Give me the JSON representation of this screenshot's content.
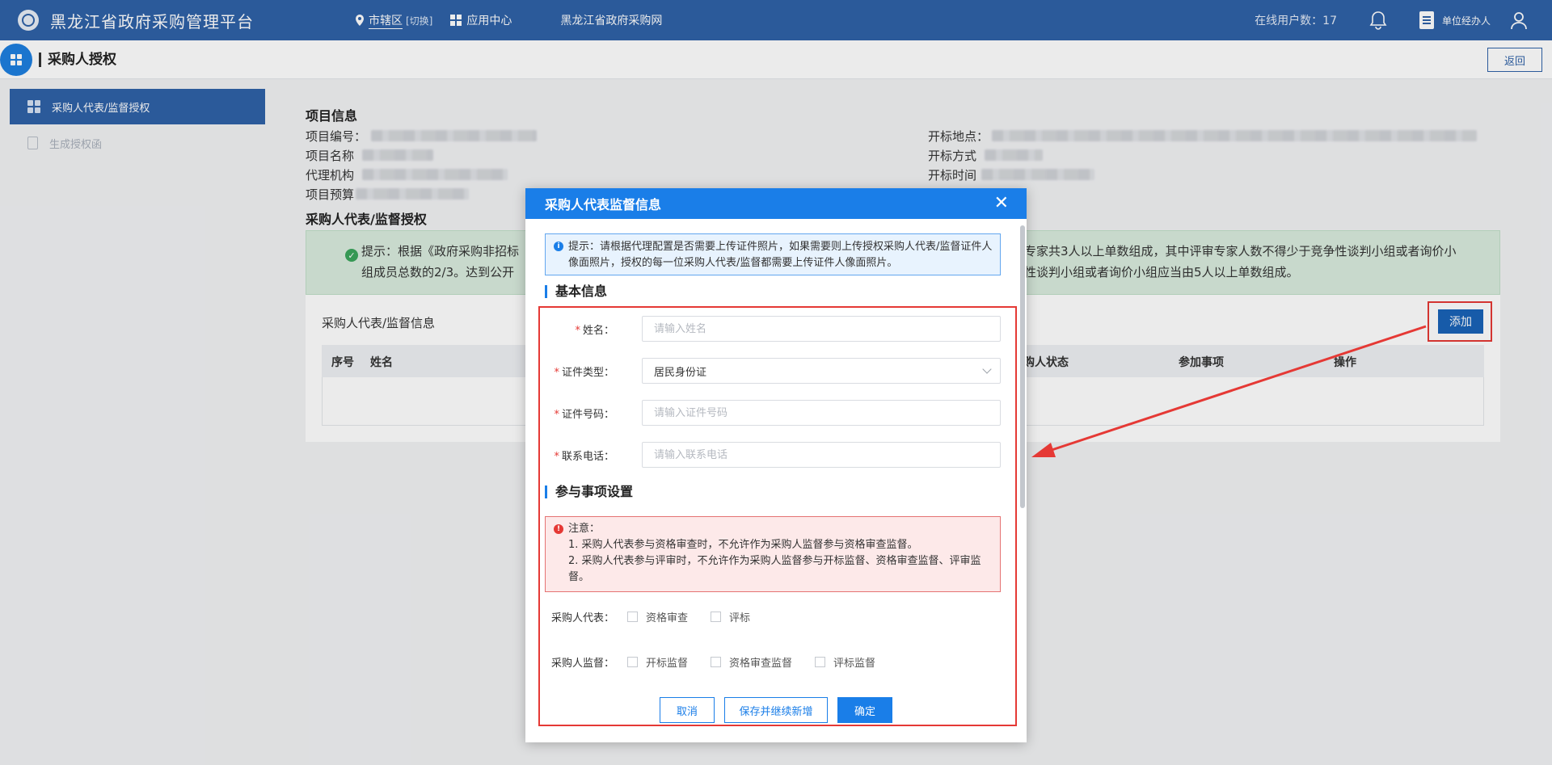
{
  "topbar": {
    "app_title": "黑龙江省政府采购管理平台",
    "region": "市辖区",
    "switch": "[切换]",
    "app_center": "应用中心",
    "gov_site": "黑龙江省政府采购网",
    "online_users": "在线用户数：17",
    "user_role": "单位经办人"
  },
  "page": {
    "title": "采购人授权",
    "back": "返回"
  },
  "sidebar": {
    "items": [
      {
        "label": "采购人代表/监督授权",
        "icon": "tiles-icon"
      },
      {
        "label": "生成授权函",
        "icon": "file-icon"
      }
    ]
  },
  "project_info": {
    "heading": "项目信息",
    "left_labels": [
      "项目编号：",
      "项目名称",
      "代理机构",
      "项目预算"
    ],
    "right_labels": [
      "开标地点：",
      "开标方式",
      "开标时间"
    ]
  },
  "auth_section": {
    "heading": "采购人代表/监督授权",
    "tip_left_1": "提示：根据《政府采购非招标",
    "tip_left_2": "组成员总数的2/3。达到公开",
    "tip_right_1": "专家共3人以上单数组成，其中评审专家人数不得少于竞争性谈判小组或者询价小",
    "tip_right_2": "性谈判小组或者询价小组应当由5人以上单数组成。",
    "panel_title": "采购人代表/监督信息",
    "add_button": "添加",
    "columns": [
      "序号",
      "姓名",
      "购人状态",
      "参加事项",
      "操作"
    ]
  },
  "modal": {
    "title": "采购人代表监督信息",
    "info_tip": "提示：请根据代理配置是否需要上传证件照片，如果需要则上传授权采购人代表/监督证件人像面照片，授权的每一位采购人代表/监督都需要上传证件人像面照片。",
    "basic_title": "基本信息",
    "name_label": "姓名：",
    "name_placeholder": "请输入姓名",
    "id_type_label": "证件类型：",
    "id_type_value": "居民身份证",
    "id_no_label": "证件号码：",
    "id_no_placeholder": "请输入证件号码",
    "phone_label": "联系电话：",
    "phone_placeholder": "请输入联系电话",
    "participation_title": "参与事项设置",
    "warn_title": "注意：",
    "warn_1": "1. 采购人代表参与资格审查时，不允许作为采购人监督参与资格审查监督。",
    "warn_2": "2. 采购人代表参与评审时，不允许作为采购人监督参与开标监督、资格审查监督、评审监督。",
    "rep_label": "采购人代表：",
    "rep_options": [
      "资格审查",
      "评标"
    ],
    "sup_label": "采购人监督：",
    "sup_options": [
      "开标监督",
      "资格审查监督",
      "评标监督"
    ],
    "cancel": "取消",
    "save_continue": "保存并继续新增",
    "confirm": "确定"
  },
  "colors": {
    "topbar": "#2f62a8",
    "primary": "#1a7ee8",
    "highlight": "#e53935"
  }
}
